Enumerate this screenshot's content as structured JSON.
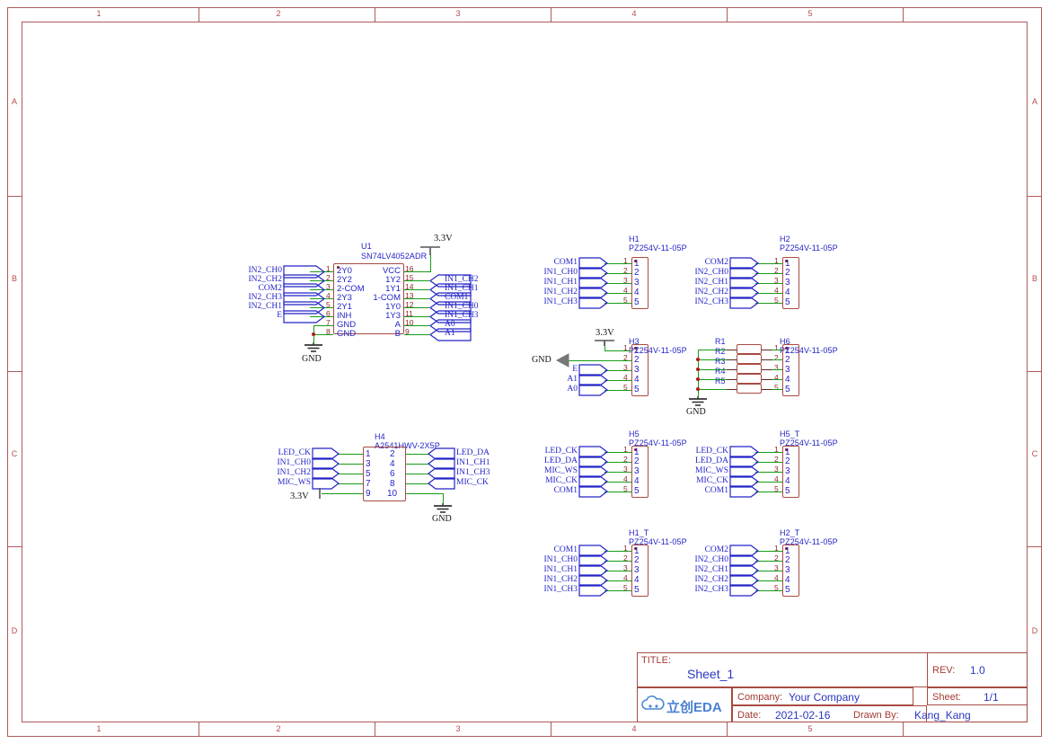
{
  "sheet": {
    "zones_top": [
      "1",
      "2",
      "3",
      "4",
      "5"
    ],
    "zones_bottom": [
      "1",
      "2",
      "3",
      "4",
      "5"
    ],
    "zones_left": [
      "A",
      "B",
      "C",
      "D"
    ],
    "zones_right": [
      "A",
      "B",
      "C",
      "D"
    ]
  },
  "title_block": {
    "title_label": "TITLE:",
    "title_value": "Sheet_1",
    "rev_label": "REV:",
    "rev_value": "1.0",
    "company_label": "Company:",
    "company_value": "Your Company",
    "sheet_label": "Sheet:",
    "sheet_value": "1/1",
    "date_label": "Date:",
    "date_value": "2021-02-16",
    "drawn_label": "Drawn By:",
    "drawn_value": "Kang_Kang",
    "logo_text": "立创EDA"
  },
  "u1": {
    "refdes": "U1",
    "part": "SN74LV4052ADR",
    "left_pins": [
      {
        "num": "1",
        "name": "2Y0",
        "net": "IN2_CH0"
      },
      {
        "num": "2",
        "name": "2Y2",
        "net": "IN2_CH2"
      },
      {
        "num": "3",
        "name": "2-COM",
        "net": "COM2"
      },
      {
        "num": "4",
        "name": "2Y3",
        "net": "IN2_CH3"
      },
      {
        "num": "5",
        "name": "2Y1",
        "net": "IN2_CH1"
      },
      {
        "num": "6",
        "name": "INH",
        "net": "E"
      },
      {
        "num": "7",
        "name": "GND",
        "net": ""
      },
      {
        "num": "8",
        "name": "GND",
        "net": ""
      }
    ],
    "right_pins": [
      {
        "num": "16",
        "name": "VCC",
        "net": ""
      },
      {
        "num": "15",
        "name": "1Y2",
        "net": "IN1_CH2"
      },
      {
        "num": "14",
        "name": "1Y1",
        "net": "IN1_CH1"
      },
      {
        "num": "13",
        "name": "1-COM",
        "net": "COM1"
      },
      {
        "num": "12",
        "name": "1Y0",
        "net": "IN1_CH0"
      },
      {
        "num": "11",
        "name": "1Y3",
        "net": "IN1_CH3"
      },
      {
        "num": "10",
        "name": "A",
        "net": "A0"
      },
      {
        "num": "9",
        "name": "B",
        "net": "A1"
      }
    ],
    "vcc_label": "3.3V",
    "gnd_label": "GND"
  },
  "h1": {
    "refdes": "H1",
    "part": "PZ254V-11-05P",
    "pins": [
      "1",
      "2",
      "3",
      "4",
      "5"
    ],
    "nets": [
      "COM1",
      "IN1_CH0",
      "IN1_CH1",
      "IN1_CH2",
      "IN1_CH3"
    ]
  },
  "h2": {
    "refdes": "H2",
    "part": "PZ254V-11-05P",
    "pins": [
      "1",
      "2",
      "3",
      "4",
      "5"
    ],
    "nets": [
      "COM2",
      "IN2_CH0",
      "IN2_CH1",
      "IN2_CH2",
      "IN2_CH3"
    ]
  },
  "h3": {
    "refdes": "H3",
    "part": "PZ254V-11-05P",
    "pins": [
      "1",
      "2",
      "3",
      "4",
      "5"
    ],
    "nets": [
      "3.3V",
      "GND",
      "E",
      "A1",
      "A0"
    ]
  },
  "h6": {
    "refdes": "H6",
    "part": "PZ254V-11-05P",
    "pins": [
      "1",
      "2",
      "3",
      "4",
      "5"
    ],
    "resistors": [
      "R1",
      "R2",
      "R3",
      "R4",
      "R5"
    ],
    "gnd_label": "GND"
  },
  "h4": {
    "refdes": "H4",
    "part": "A2541HWV-2X5P",
    "left_pins": [
      "1",
      "3",
      "5",
      "7",
      "9"
    ],
    "right_pins": [
      "2",
      "4",
      "6",
      "8",
      "10"
    ],
    "left_nets": [
      "LED_CK",
      "IN1_CH0",
      "IN1_CH2",
      "MIC_WS",
      "3.3V"
    ],
    "right_nets": [
      "LED_DA",
      "IN1_CH1",
      "IN1_CH3",
      "MIC_CK",
      ""
    ],
    "gnd_label": "GND"
  },
  "h5": {
    "refdes": "H5",
    "part": "PZ254V-11-05P",
    "pins": [
      "1",
      "2",
      "3",
      "4",
      "5"
    ],
    "nets": [
      "LED_CK",
      "LED_DA",
      "MIC_WS",
      "MIC_CK",
      "COM1"
    ]
  },
  "h5t": {
    "refdes": "H5_T",
    "part": "PZ254V-11-05P",
    "pins": [
      "1",
      "2",
      "3",
      "4",
      "5"
    ],
    "nets": [
      "LED_CK",
      "LED_DA",
      "MIC_WS",
      "MIC_CK",
      "COM1"
    ]
  },
  "h1t": {
    "refdes": "H1_T",
    "part": "PZ254V-11-05P",
    "pins": [
      "1",
      "2",
      "3",
      "4",
      "5"
    ],
    "nets": [
      "COM1",
      "IN1_CH0",
      "IN1_CH1",
      "IN1_CH2",
      "IN1_CH3"
    ]
  },
  "h2t": {
    "refdes": "H2_T",
    "part": "PZ254V-11-05P",
    "pins": [
      "1",
      "2",
      "3",
      "4",
      "5"
    ],
    "nets": [
      "COM2",
      "IN2_CH0",
      "IN2_CH1",
      "IN2_CH2",
      "IN2_CH3"
    ]
  },
  "colors": {
    "frame": "#b05a5a",
    "wire": "#169c16",
    "symbol_outline": "#a84b43",
    "label": "#2323c8",
    "pin_number": "#8b2b2b"
  }
}
